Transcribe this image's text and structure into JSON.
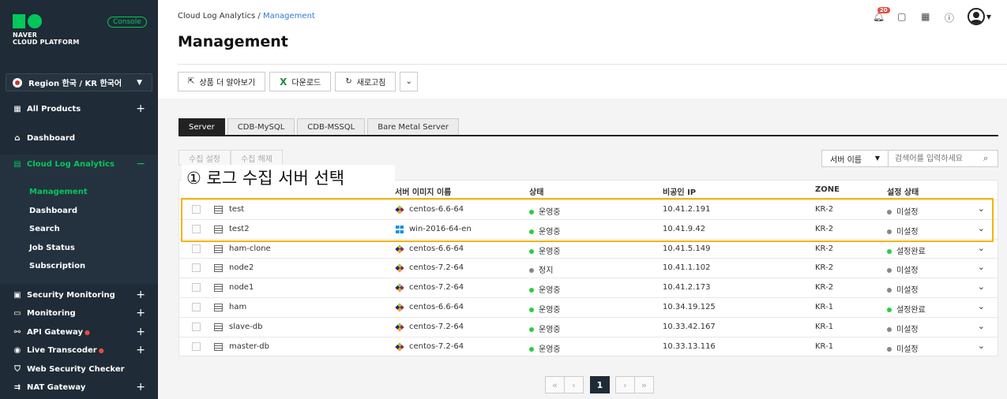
{
  "brand": {
    "line1": "NAVER",
    "line2": "CLOUD PLATFORM",
    "console_badge": "Console"
  },
  "region": {
    "label": "Region 한국 / KR 한국어"
  },
  "sidebar": {
    "items": [
      {
        "label": "All Products",
        "icon": "grid-icon",
        "expand": "+"
      },
      {
        "label": "Dashboard",
        "icon": "home-icon"
      },
      {
        "label": "Cloud Log Analytics",
        "icon": "log-icon",
        "expand": "−"
      },
      {
        "label": "Security Monitoring",
        "icon": "monitor-icon",
        "expand": "+"
      },
      {
        "label": "Monitoring",
        "icon": "monitor-icon",
        "expand": "+"
      },
      {
        "label": "API Gateway",
        "icon": "api-icon",
        "expand": "+",
        "new": "●"
      },
      {
        "label": "Live Transcoder",
        "icon": "broadcast-icon",
        "expand": "+",
        "new": "●"
      },
      {
        "label": "Web Security Checker",
        "icon": "shield-icon"
      },
      {
        "label": "NAT Gateway",
        "icon": "nat-icon",
        "expand": "+"
      }
    ],
    "sub_items": [
      "Management",
      "Dashboard",
      "Search",
      "Job Status",
      "Subscription"
    ]
  },
  "header": {
    "breadcrumb_root": "Cloud Log Analytics",
    "breadcrumb_sep": "/",
    "breadcrumb_current": "Management",
    "title": "Management",
    "notification_count": "20"
  },
  "toolbar": {
    "learn_more": "상품 더 알아보기",
    "download": "다운로드",
    "refresh": "새로고침"
  },
  "tabs": [
    "Server",
    "CDB-MySQL",
    "CDB-MSSQL",
    "Bare Metal Server"
  ],
  "collect": {
    "setup": "수집 설정",
    "release": "수집 해제"
  },
  "search": {
    "select": "서버 이름",
    "placeholder": "검색어를 입력하세요"
  },
  "annotation": "① 로그 수집 서버 선택",
  "table": {
    "headers": {
      "image": "서버 이미지 이름",
      "status": "상태",
      "ip": "비공인 IP",
      "zone": "ZONE",
      "setup": "설정 상태"
    },
    "rows": [
      {
        "name": "test",
        "os": "centos",
        "image": "centos-6.6-64",
        "status": "운영중",
        "status_color": "#2ecc40",
        "ip": "10.41.2.191",
        "zone": "KR-2",
        "setup": "미설정",
        "setup_color": "#888888"
      },
      {
        "name": "test2",
        "os": "win",
        "image": "win-2016-64-en",
        "status": "운영중",
        "status_color": "#2ecc40",
        "ip": "10.41.9.42",
        "zone": "KR-2",
        "setup": "미설정",
        "setup_color": "#888888"
      },
      {
        "name": "ham-clone",
        "os": "centos",
        "image": "centos-6.6-64",
        "status": "운영중",
        "status_color": "#2ecc40",
        "ip": "10.41.5.149",
        "zone": "KR-2",
        "setup": "설정완료",
        "setup_color": "#2ecc40"
      },
      {
        "name": "node2",
        "os": "centos",
        "image": "centos-7.2-64",
        "status": "정지",
        "status_color": "#888888",
        "ip": "10.41.1.102",
        "zone": "KR-2",
        "setup": "미설정",
        "setup_color": "#888888"
      },
      {
        "name": "node1",
        "os": "centos",
        "image": "centos-7.2-64",
        "status": "운영중",
        "status_color": "#2ecc40",
        "ip": "10.41.2.173",
        "zone": "KR-2",
        "setup": "미설정",
        "setup_color": "#888888"
      },
      {
        "name": "ham",
        "os": "centos",
        "image": "centos-6.6-64",
        "status": "운영중",
        "status_color": "#2ecc40",
        "ip": "10.34.19.125",
        "zone": "KR-1",
        "setup": "설정완료",
        "setup_color": "#2ecc40"
      },
      {
        "name": "slave-db",
        "os": "centos",
        "image": "centos-7.2-64",
        "status": "운영중",
        "status_color": "#2ecc40",
        "ip": "10.33.42.167",
        "zone": "KR-1",
        "setup": "미설정",
        "setup_color": "#888888"
      },
      {
        "name": "master-db",
        "os": "centos",
        "image": "centos-7.2-64",
        "status": "운영중",
        "status_color": "#2ecc40",
        "ip": "10.33.13.116",
        "zone": "KR-1",
        "setup": "미설정",
        "setup_color": "#888888"
      }
    ]
  },
  "pagination": {
    "current": "1"
  },
  "colors": {
    "accent": "#03c75a",
    "sidebar_bg": "#1f2b36",
    "highlight": "#f5b400"
  }
}
